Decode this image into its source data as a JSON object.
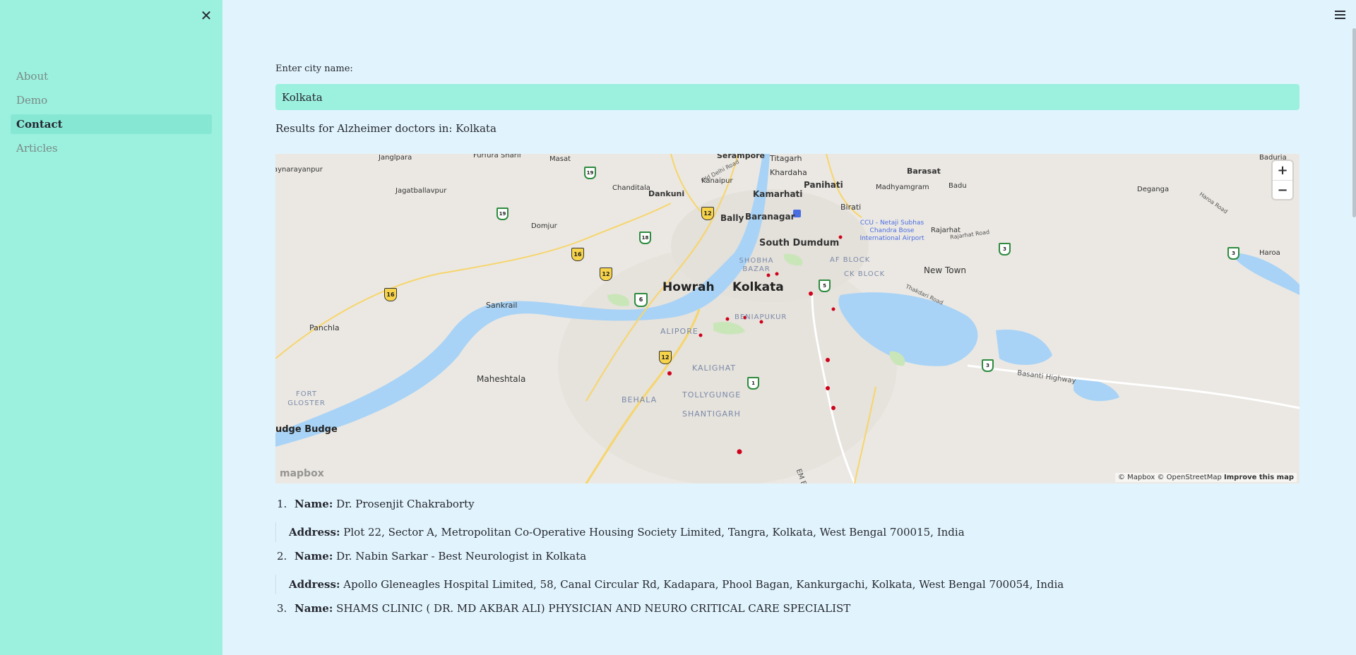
{
  "sidebar": {
    "close_label": "✕",
    "items": [
      {
        "label": "About"
      },
      {
        "label": "Demo"
      },
      {
        "label": "Contact"
      },
      {
        "label": "Articles"
      }
    ]
  },
  "search": {
    "label": "Enter city name:",
    "value": "Kolkata"
  },
  "results_title": "Results for Alzheimer doctors in: Kolkata",
  "map": {
    "zoom_in": "+",
    "zoom_out": "−",
    "logo": "mapbox",
    "attribution_text": "© Mapbox © OpenStreetMap",
    "improve_link": "Improve this map",
    "labels": {
      "howrah": "Howrah",
      "kolkata": "Kolkata",
      "south_dumdum": "South Dumdum",
      "baranagar": "Baranagar",
      "kamarhati": "Kamarhati",
      "panihati": "Panihati",
      "bally": "Bally",
      "dankuni": "Dankuni",
      "serampore": "Serampore",
      "titagarh": "Titagarh",
      "khardaha": "Khardaha",
      "barasat": "Barasat",
      "birati": "Birati",
      "madhyamgram": "Madhyamgram",
      "badu": "Badu",
      "deganga": "Deganga",
      "rajarhat": "Rajarhat",
      "new_town": "New Town",
      "haroa": "Haroa",
      "maheshtala": "Maheshtala",
      "budge_budge": "udge Budge",
      "sankrail": "Sankrail",
      "panchla": "Panchla",
      "domjur": "Domjur",
      "jagatballavpur": "Jagatballavpur",
      "janglpara": "Janglpara",
      "furfura": "Furfura Sharif",
      "masat": "Masat",
      "chanditala": "Chanditala",
      "kanaipur": "Kanaipur",
      "jaynarayanpur": "Jaynarayanpur",
      "baduria": "Baduria",
      "behala": "BEHALA",
      "tollygunge": "TOLLYGUNGE",
      "shantigarh": "SHANTIGARH",
      "kalighat": "KALIGHAT",
      "alipore": "ALIPORE",
      "beniapukur": "BENIAPUKUR",
      "shobha_bazar": "SHOBHA BAZAR",
      "af_block": "AF BLOCK",
      "ck_block": "CK BLOCK",
      "fort_gloster": "FORT GLOSTER",
      "airport": "CCU - Netaji Subhas Chandra Bose International Airport",
      "basanti": "Basanti Highway",
      "em_bypass": "EM Bypass",
      "old_delhi_rd": "Old Delhi Road",
      "thakdari": "Thakdari Road",
      "rajarhat_rd": "Rajarhat Road",
      "haroa_rd": "Haroa Road"
    },
    "shields": [
      "16",
      "12",
      "16",
      "12",
      "12",
      "6",
      "18",
      "19",
      "19",
      "1",
      "3",
      "3",
      "3",
      "5"
    ]
  },
  "results": [
    {
      "num": "1.",
      "name_label": "Name:",
      "name": "Dr. Prosenjit Chakraborty",
      "address_label": "Address:",
      "address": "Plot 22, Sector A, Metropolitan Co-Operative Housing Society Limited, Tangra, Kolkata, West Bengal 700015, India"
    },
    {
      "num": "2.",
      "name_label": "Name:",
      "name": "Dr. Nabin Sarkar - Best Neurologist in Kolkata",
      "address_label": "Address:",
      "address": "Apollo Gleneagles Hospital Limited, 58, Canal Circular Rd, Kadapara, Phool Bagan, Kankurgachi, Kolkata, West Bengal 700054, India"
    },
    {
      "num": "3.",
      "name_label": "Name:",
      "name": "SHAMS CLINIC ( DR. MD AKBAR ALI) PHYSICIAN AND NEURO CRITICAL CARE SPECIALIST"
    }
  ]
}
